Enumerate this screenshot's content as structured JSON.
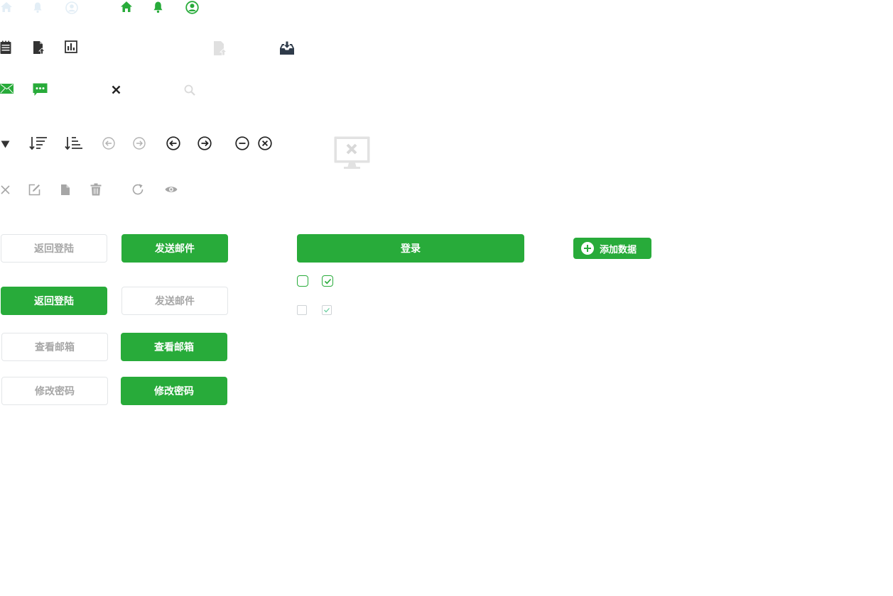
{
  "colors": {
    "brand_green": "#28ab3a",
    "dark_icon": "#333333",
    "navy_icon": "#2f3b4a",
    "muted_gray": "#a6a6a6",
    "light_gray": "#d9d9d9",
    "outline_border": "#e3e6e8",
    "pale_blue": "#e3eef6"
  },
  "icons": {
    "row1": [
      "home-icon-inactive",
      "bell-icon-inactive",
      "user-icon-inactive",
      "home-icon-active",
      "bell-icon-active",
      "user-icon-active"
    ],
    "row2": [
      "list-icon",
      "file-upload-icon",
      "bar-chart-icon",
      "file-upload-icon-disabled",
      "inbox-download-icon"
    ],
    "row3": [
      "mail-icon",
      "chat-icon",
      "close-icon",
      "search-icon"
    ],
    "row4": [
      "caret-down-icon",
      "sort-desc-icon",
      "sort-asc-icon",
      "arrow-left-circle-icon-disabled",
      "arrow-right-circle-icon-disabled",
      "arrow-left-circle-icon",
      "arrow-right-circle-icon",
      "minus-circle-icon",
      "close-circle-icon",
      "monitor-error-icon"
    ],
    "row5": [
      "close-icon-gray",
      "edit-icon",
      "file-icon",
      "trash-icon",
      "refresh-icon",
      "eye-icon"
    ]
  },
  "buttons": {
    "back_login": "返回登陆",
    "send_email": "发送邮件",
    "view_mailbox": "查看邮箱",
    "change_password": "修改密码",
    "login": "登录",
    "add_data": "添加数据"
  },
  "checkboxes": {
    "large_unchecked": false,
    "large_checked": true,
    "small_unchecked": false,
    "small_checked": true
  }
}
